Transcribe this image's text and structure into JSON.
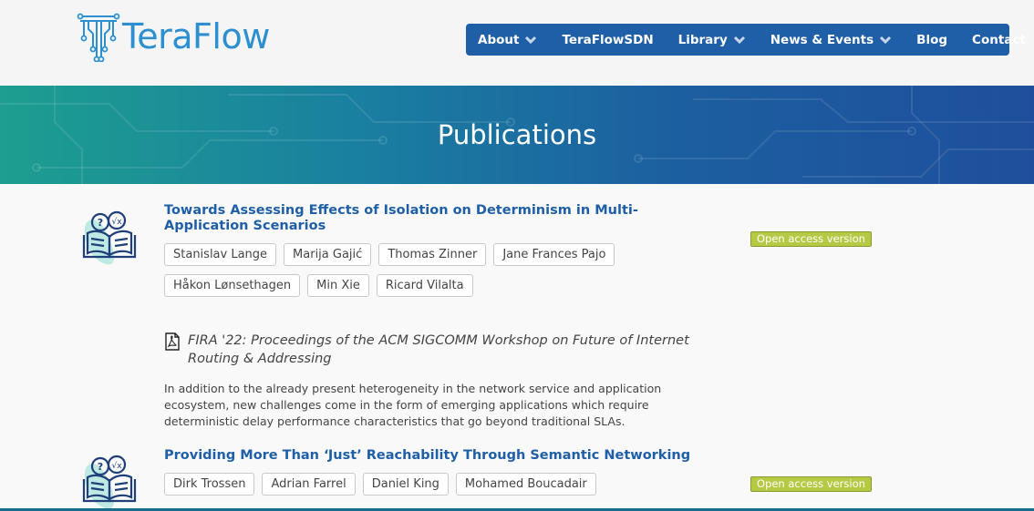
{
  "brand": {
    "logo_text": "TeraFlow",
    "accent": "#1f5fa8",
    "logo_color": "#2b8fd0"
  },
  "nav": {
    "items": [
      {
        "label": "About",
        "has_dropdown": true
      },
      {
        "label": "TeraFlowSDN",
        "has_dropdown": false
      },
      {
        "label": "Library",
        "has_dropdown": true
      },
      {
        "label": "News & Events",
        "has_dropdown": true
      },
      {
        "label": "Blog",
        "has_dropdown": false
      },
      {
        "label": "Contact",
        "has_dropdown": false
      }
    ]
  },
  "banner": {
    "title": "Publications"
  },
  "publications": [
    {
      "title": "Towards Assessing Effects of Isolation on Determinism in Multi-Application Scenarios",
      "authors": [
        "Stanislav Lange",
        "Marija Gajić",
        "Thomas Zinner",
        "Jane Frances Pajo",
        "Håkon Lønsethagen",
        "Min Xie",
        "Ricard Vilalta"
      ],
      "open_access_label": "Open access version",
      "venue": "FIRA '22: Proceedings of the ACM SIGCOMM Workshop on Future of Internet Routing & Addressing",
      "abstract": "In addition to the already present heterogeneity in the network service and application ecosystem, new challenges come in the form of emerging applications which require deterministic delay performance characteristics that go beyond traditional SLAs."
    },
    {
      "title": "Providing More Than ‘Just’ Reachability Through Semantic Networking",
      "authors": [
        "Dirk Trossen",
        "Adrian Farrel",
        "Daniel King",
        "Mohamed Boucadair"
      ],
      "open_access_label": "Open access version"
    }
  ]
}
